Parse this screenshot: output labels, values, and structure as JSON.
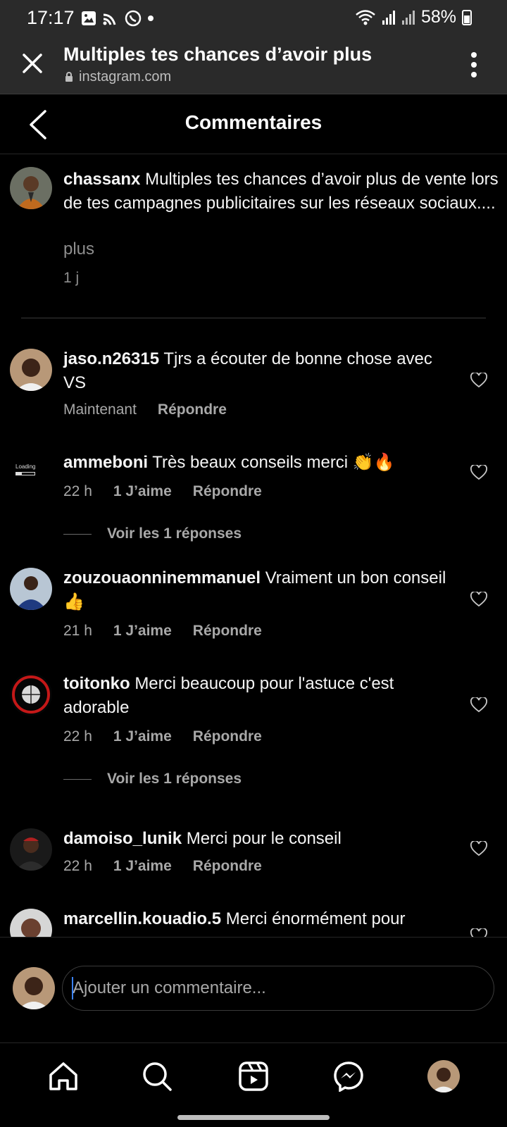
{
  "status_bar": {
    "time": "17:17",
    "battery": "58%"
  },
  "browser": {
    "title": "Multiples tes chances d’avoir plus",
    "url": "instagram.com"
  },
  "header": {
    "title": "Commentaires"
  },
  "caption": {
    "username": "chassanx",
    "text": "Multiples tes chances d’avoir plus de vente lors de tes campagnes publicitaires sur les réseaux sociaux....",
    "more": "plus",
    "time": "1 j"
  },
  "comments": [
    {
      "username": "jaso.n26315",
      "text": "Tjrs a écouter de bonne chose avec VS",
      "time": "Maintenant",
      "likes": "",
      "reply": "Répondre"
    },
    {
      "username": "ammeboni",
      "text": "Très beaux conseils merci 👏🔥",
      "time": "22 h",
      "likes": "1 J’aime",
      "reply": "Répondre",
      "view_replies": "Voir les 1 réponses",
      "avatar_loading": "Loading"
    },
    {
      "username": "zouzouaonninemmanuel",
      "text": "Vraiment un bon conseil 👍",
      "time": "21 h",
      "likes": "1 J’aime",
      "reply": "Répondre"
    },
    {
      "username": "toitonko",
      "text": "Merci beaucoup pour l'astuce c'est adorable",
      "time": "22 h",
      "likes": "1 J’aime",
      "reply": "Répondre",
      "view_replies": "Voir les 1 réponses"
    },
    {
      "username": "damoiso_lunik",
      "text": "Merci pour le conseil",
      "time": "22 h",
      "likes": "1 J’aime",
      "reply": "Répondre"
    },
    {
      "username": "marcellin.kouadio.5",
      "text": "Merci énormément pour"
    }
  ],
  "input": {
    "placeholder": "Ajouter un commentaire..."
  },
  "nav": [
    "home-icon",
    "search-icon",
    "reels-icon",
    "messenger-icon",
    "profile-avatar"
  ]
}
